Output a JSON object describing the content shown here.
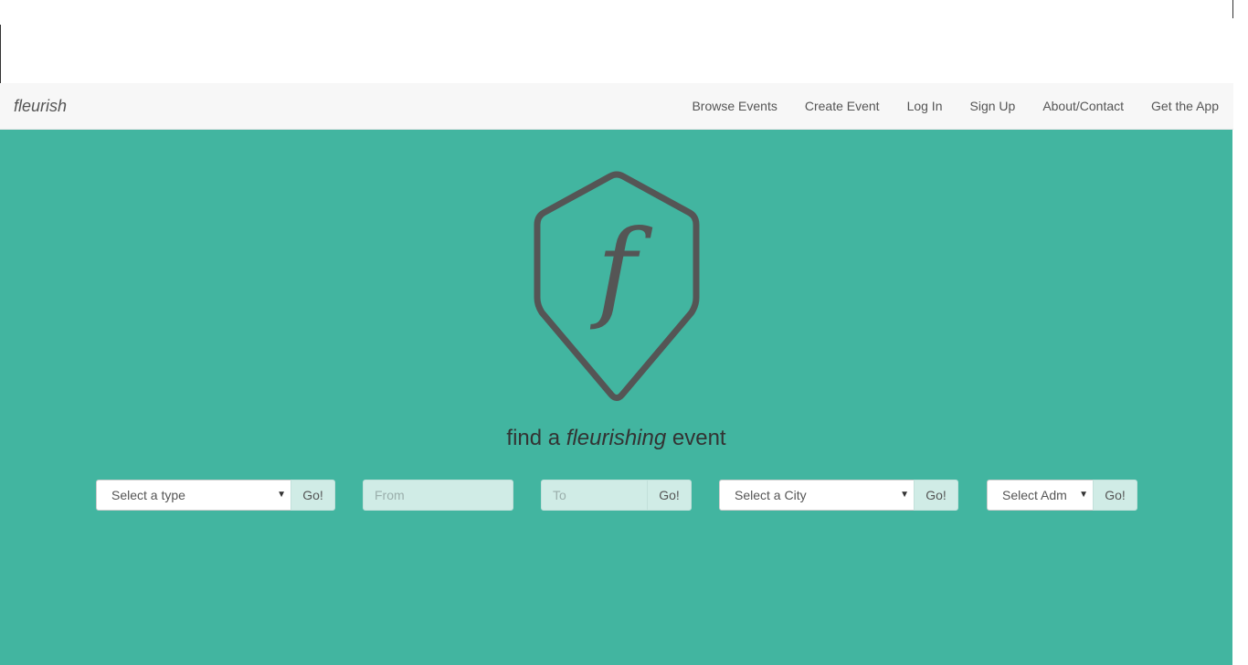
{
  "navbar": {
    "brand": "fleurish",
    "links": [
      "Browse Events",
      "Create Event",
      "Log In",
      "Sign Up",
      "About/Contact",
      "Get the App"
    ]
  },
  "hero": {
    "logo_letter": "f",
    "tagline_prefix": "find a ",
    "tagline_emphasis": "fleurishing",
    "tagline_suffix": " event"
  },
  "filters": {
    "type_select": "Select a type",
    "date_from_placeholder": "From",
    "date_to_placeholder": "To",
    "city_select": "Select a City",
    "admin_select": "Select Adm",
    "go_label": "Go!"
  },
  "colors": {
    "hero_bg": "#42b5a0",
    "navbar_bg": "#f7f7f7",
    "logo_stroke": "#555555",
    "input_bg": "#d0ece6"
  }
}
